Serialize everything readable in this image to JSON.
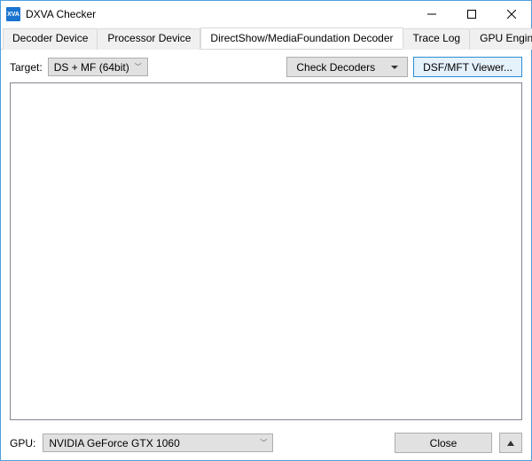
{
  "window": {
    "title": "DXVA Checker",
    "icon_text": "XVA"
  },
  "tabs": [
    {
      "label": "Decoder Device",
      "active": false
    },
    {
      "label": "Processor Device",
      "active": false
    },
    {
      "label": "DirectShow/MediaFoundation Decoder",
      "active": true
    },
    {
      "label": "Trace Log",
      "active": false
    },
    {
      "label": "GPU Engine Usage",
      "active": false
    }
  ],
  "toolbar": {
    "target_label": "Target:",
    "target_value": "DS + MF (64bit)",
    "check_decoders": "Check Decoders",
    "dsf_viewer": "DSF/MFT Viewer..."
  },
  "footer": {
    "gpu_label": "GPU:",
    "gpu_value": "NVIDIA GeForce GTX 1060",
    "close": "Close"
  }
}
